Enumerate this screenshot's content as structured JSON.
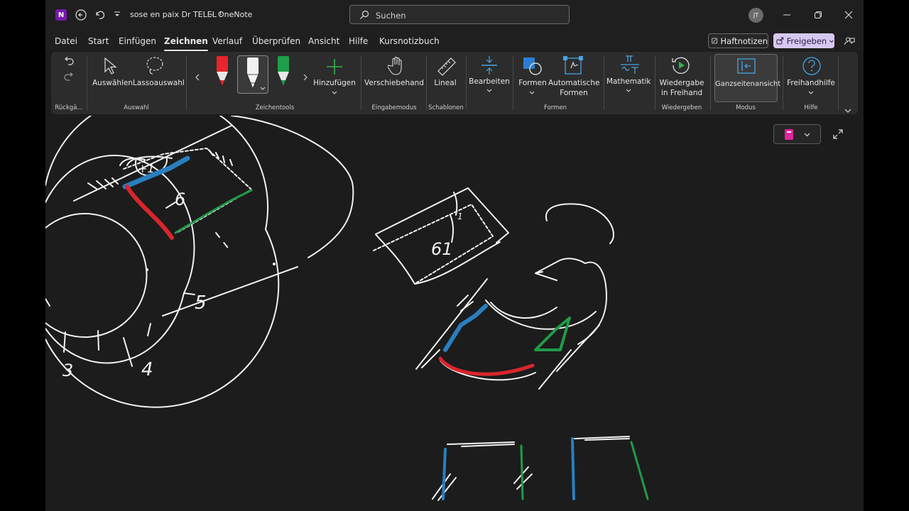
{
  "window": {
    "app_logo_letter": "N",
    "title": "sose en paix Dr TELEL !",
    "title_separator": "-",
    "app_name": "OneNote",
    "user_initials": "JT"
  },
  "search": {
    "placeholder": "Suchen"
  },
  "menu": {
    "tabs": [
      "Datei",
      "Start",
      "Einfügen",
      "Zeichnen",
      "Verlauf",
      "Überprüfen",
      "Ansicht",
      "Hilfe",
      "Kursnotizbuch"
    ],
    "active_tab": "Zeichnen",
    "haftnotizen": "Haftnotizen",
    "freigeben": "Freigeben"
  },
  "ribbon": {
    "groups": {
      "rueckgaengig": "Rückgä...",
      "auswahl": "Auswahl",
      "zeichentools": "Zeichentools",
      "eingabemodus": "Eingabemodus",
      "schablonen": "Schablonen",
      "formen": "Formen",
      "wiedergeben": "Wiedergeben",
      "modus": "Modus",
      "hilfe": "Hilfe"
    },
    "buttons": {
      "auswaehlen": "Auswählen",
      "lassoauswahl": "Lassoauswahl",
      "hinzufuegen": "Hinzufügen",
      "verschiebehand": "Verschiebehand",
      "lineal": "Lineal",
      "bearbeiten": "Bearbeiten",
      "formen": "Formen",
      "automatische_1": "Automatische",
      "automatische_2": "Formen",
      "mathematik": "Mathematik",
      "wiedergabe_1": "Wiedergabe",
      "wiedergabe_2": "in Freihand",
      "ganzseitenansicht": "Ganzseitenansicht",
      "freihandhilfe": "Freihandhilfe"
    },
    "pen_colors": [
      "#e8242c",
      "#f2f2f2",
      "#1e9e4a"
    ]
  },
  "canvas": {
    "ink_labels": [
      "+1",
      "6",
      "5",
      "3",
      "4",
      "61",
      "1"
    ],
    "ink_colors": {
      "white": "#f2f2f2",
      "blue": "#2a7fbf",
      "red": "#d8262c",
      "green": "#1f9b4a"
    }
  },
  "colors": {
    "accent_purple": "#7719aa",
    "share_bg": "#d7c8f2",
    "notebook_icon": "#e0259a"
  }
}
